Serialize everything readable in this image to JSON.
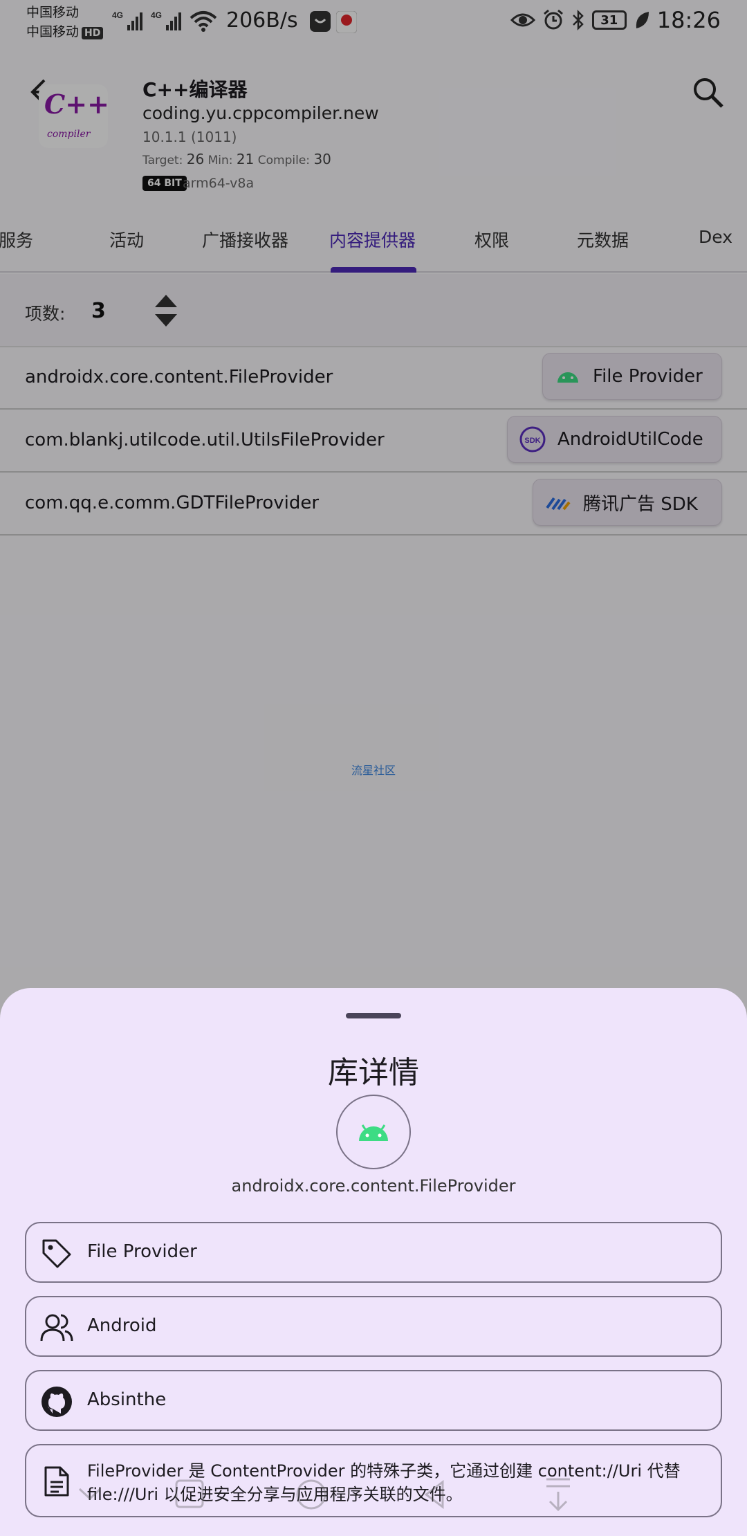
{
  "status_bar": {
    "carrier1": "中国移动",
    "carrier2": "中国移动",
    "hd_badge": "HD",
    "net1": "4G",
    "net2": "4G",
    "net_speed": "206B/s",
    "battery": "31",
    "time": "18:26"
  },
  "app": {
    "name": "C++编译器",
    "package": "coding.yu.cppcompiler.new",
    "version": "10.1.1 (1011)",
    "target_label": "Target:",
    "target": "26",
    "min_label": "Min:",
    "min": "21",
    "compile_label": "Compile:",
    "compile": "30",
    "bit_badge": "64 BIT",
    "arch": "arm64-v8a",
    "logo_main": "C++",
    "logo_sub": "compiler"
  },
  "tabs": [
    {
      "label": "服务"
    },
    {
      "label": "活动"
    },
    {
      "label": "广播接收器"
    },
    {
      "label": "内容提供器"
    },
    {
      "label": "权限"
    },
    {
      "label": "元数据"
    },
    {
      "label": "Dex"
    }
  ],
  "active_tab": "内容提供器",
  "count": {
    "label": "项数:",
    "value": "3"
  },
  "providers": [
    {
      "name": "androidx.core.content.FileProvider",
      "lib": "File Provider",
      "icon": "android-icon"
    },
    {
      "name": "com.blankj.utilcode.util.UtilsFileProvider",
      "lib": "AndroidUtilCode",
      "icon": "sdk-icon"
    },
    {
      "name": "com.qq.e.comm.GDTFileProvider",
      "lib": "腾讯广告 SDK",
      "icon": "tencent-ads-icon"
    }
  ],
  "watermark": "流星社区",
  "sheet": {
    "title": "库详情",
    "lib_name": "androidx.core.content.FileProvider",
    "label": "File Provider",
    "team": "Android",
    "contributor": "Absinthe",
    "description": "FileProvider 是 ContentProvider 的特殊子类，它通过创建 content://Uri 代替 file:///Uri 以促进安全分享与应用程序关联的文件。"
  },
  "colors": {
    "accent": "#4d2ab8",
    "sheet_bg": "#efe4fb",
    "android_green": "#3ddc84"
  }
}
